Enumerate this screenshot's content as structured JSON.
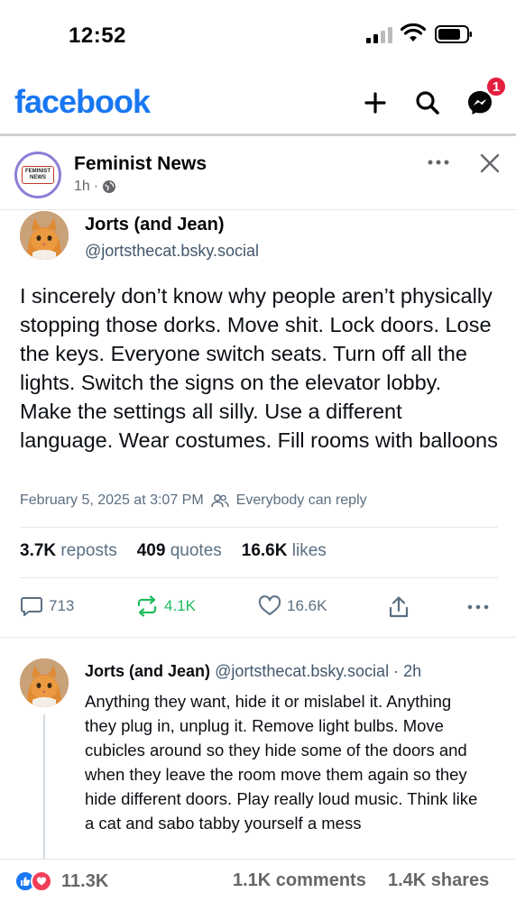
{
  "status_bar": {
    "time": "12:52"
  },
  "header": {
    "logo": "facebook",
    "brand_color": "#1877f2",
    "messenger_badge": "1",
    "icons": [
      "plus-icon",
      "search-icon",
      "messenger-icon"
    ]
  },
  "post": {
    "page_name": "Feminist News",
    "page_avatar_text": [
      "FEMINIST",
      "NEWS"
    ],
    "time": "1h",
    "visibility_icon": "globe-icon",
    "separator": "·"
  },
  "bsky_post": {
    "author": "Jorts (and Jean)",
    "handle": "@jortsthecat.bsky.social",
    "text": "I sincerely don’t know why people aren’t physically stopping those dorks. Move shit. Lock doors. Lose the keys. Everyone switch seats. Turn off all the lights. Switch the signs on the elevator lobby. Make the settings all silly. Use a different language. Wear costumes. Fill rooms with balloons",
    "date": "February 5, 2025 at 3:07 PM",
    "reply_setting": "Everybody can reply",
    "stats": {
      "reposts_count": "3.7K",
      "reposts_label": "reposts",
      "quotes_count": "409",
      "quotes_label": "quotes",
      "likes_count": "16.6K",
      "likes_label": "likes"
    },
    "actions": {
      "replies": "713",
      "reposts": "4.1K",
      "likes": "16.6K"
    },
    "repost_color": "#20bc5c"
  },
  "reply": {
    "author": "Jorts (and Jean)",
    "handle_time": "@jortsthecat.bsky.social · 2h",
    "text": "Anything they want, hide it or mislabel it. Anything they plug in, unplug it. Remove light bulbs. Move cubicles around so they hide some of the doors and when they leave the room move them again so they hide different doors. Play really loud music. Think like a cat and sabo tabby yourself a mess"
  },
  "footer": {
    "reactions_count": "11.3K",
    "comments": "1.1K comments",
    "shares": "1.4K shares"
  }
}
